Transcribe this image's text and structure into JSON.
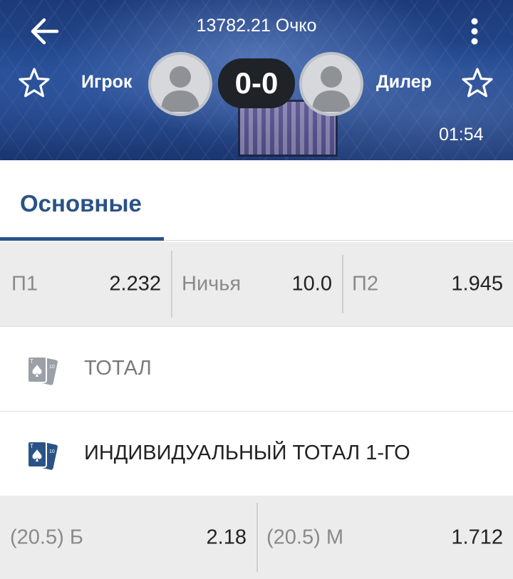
{
  "header": {
    "title": "13782.21 Очко",
    "team_left": "Игрок",
    "team_right": "Дилер",
    "score": "0-0",
    "timer": "01:54"
  },
  "tabs": [
    {
      "label": "Основные",
      "active": true
    }
  ],
  "odds_main": [
    {
      "label": "П1",
      "value": "2.232"
    },
    {
      "label": "Ничья",
      "value": "10.0"
    },
    {
      "label": "П2",
      "value": "1.945"
    }
  ],
  "markets": [
    {
      "label": "ТОТАЛ",
      "icon": "playing-cards-icon",
      "color": "#7a7a7a"
    },
    {
      "label": "ИНДИВИДУАЛЬНЫЙ ТОТАЛ 1-ГО",
      "icon": "playing-cards-icon",
      "color": "#222222"
    }
  ],
  "odds_total": [
    {
      "label": "(20.5) Б",
      "value": "2.18"
    },
    {
      "label": "(20.5) М",
      "value": "1.712"
    }
  ],
  "colors": {
    "accent": "#2a5286",
    "header_bg": "#234a91",
    "icon_inactive": "#9aa0a6",
    "icon_active": "#2a5286"
  }
}
